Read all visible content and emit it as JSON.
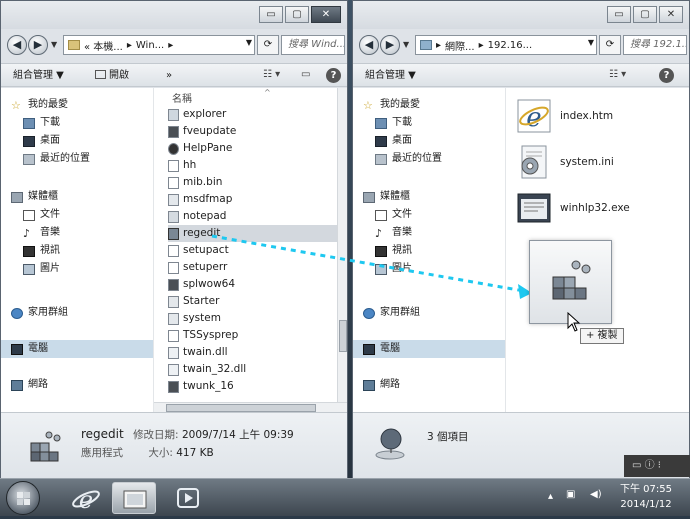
{
  "left_window": {
    "address_segments": [
      "« 本機...",
      "Win..."
    ],
    "search_placeholder": "搜尋 Wind...",
    "toolbar": {
      "organize": "組合管理 ▼",
      "open": "開啟",
      "more": "»"
    },
    "nav": {
      "favorites": {
        "header": "我的最愛",
        "items": [
          "下載",
          "桌面",
          "最近的位置"
        ]
      },
      "libraries": {
        "header": "媒體櫃",
        "items": [
          "文件",
          "音樂",
          "視訊",
          "圖片"
        ]
      },
      "homegroup": "家用群組",
      "computer": "電腦",
      "network": "網路"
    },
    "column_header": "名稱",
    "files": [
      "explorer",
      "fveupdate",
      "HelpPane",
      "hh",
      "mib.bin",
      "msdfmap",
      "notepad",
      "regedit",
      "setupact",
      "setuperr",
      "splwow64",
      "Starter",
      "system",
      "TSSysprep",
      "twain.dll",
      "twain_32.dll",
      "twunk_16"
    ],
    "selected_file": "regedit",
    "details": {
      "name": "regedit",
      "modified_label": "修改日期:",
      "modified_value": "2009/7/14 上午 09:39",
      "type": "應用程式",
      "size_label": "大小:",
      "size_value": "417 KB"
    }
  },
  "right_window": {
    "address_segments": [
      "網際...",
      "192.16..."
    ],
    "search_placeholder": "搜尋 192.1...",
    "toolbar": {
      "organize": "組合管理 ▼"
    },
    "nav": {
      "favorites": {
        "header": "我的最愛",
        "items": [
          "下載",
          "桌面",
          "最近的位置"
        ]
      },
      "libraries": {
        "header": "媒體櫃",
        "items": [
          "文件",
          "音樂",
          "視訊",
          "圖片"
        ]
      },
      "homegroup": "家用群組",
      "computer": "電腦",
      "network": "網路"
    },
    "files": [
      "index.htm",
      "system.ini",
      "winhlp32.exe"
    ],
    "details": {
      "count": "3 個項目"
    }
  },
  "drag_tooltip": "+ 複製",
  "taskbar": {
    "time": "下午 07:55",
    "date": "2014/1/12"
  },
  "window_buttons": {
    "minimize": "▭",
    "maximize": "▢",
    "close": "✕"
  },
  "colors": {
    "drag_arrow": "#1ec8f0",
    "selection": "#d3d8de",
    "nav_selection": "#c9dbe9"
  },
  "icons": [
    "back-arrow-icon",
    "forward-arrow-icon",
    "folder-icon",
    "network-icon",
    "refresh-icon",
    "search-icon",
    "star-icon",
    "ie-icon",
    "regedit-icon",
    "help-icon"
  ]
}
